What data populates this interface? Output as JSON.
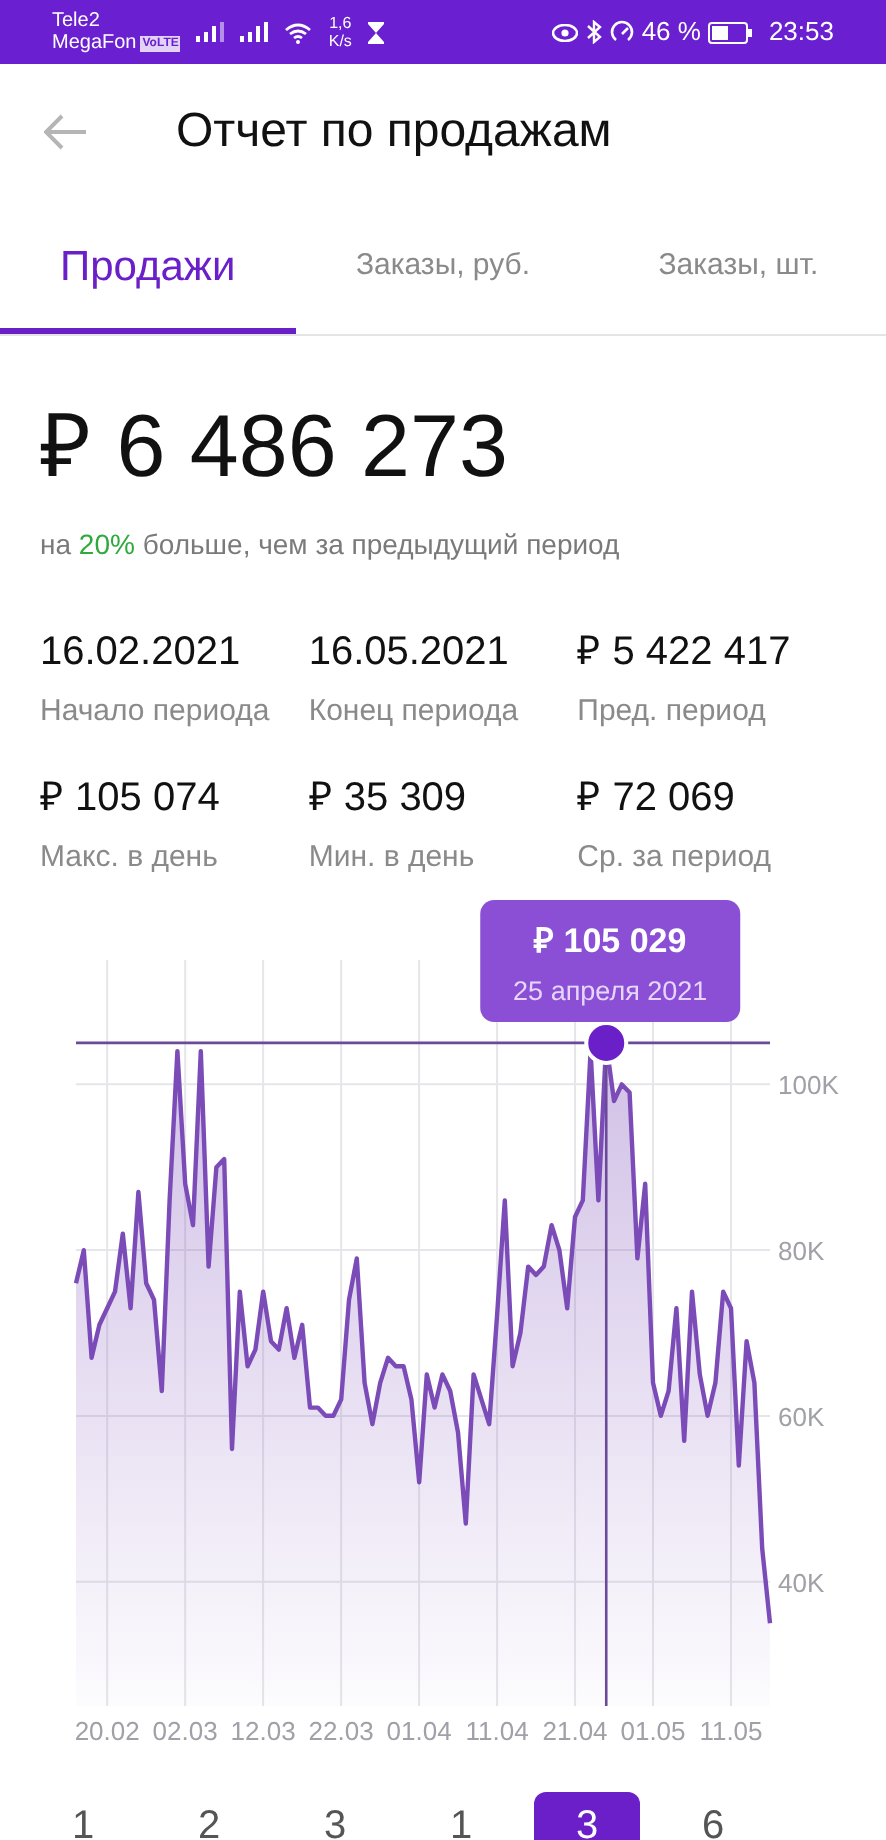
{
  "status_bar": {
    "carrier_1": "Tele2",
    "carrier_2": "MegaFon",
    "volte": "VoLTE",
    "speed": "1,6",
    "speed_unit": "K/s",
    "battery": "46 %",
    "time": "23:53"
  },
  "header": {
    "title": "Отчет по продажам"
  },
  "tabs": [
    {
      "label": "Продажи",
      "selected": true
    },
    {
      "label": "Заказы, руб.",
      "selected": false
    },
    {
      "label": "Заказы, шт.",
      "selected": false
    }
  ],
  "total": {
    "value": "₽ 6 486 273",
    "comparison": {
      "prefix": "на ",
      "highlight": "20%",
      "suffix": " больше, чем за предыдущий период"
    }
  },
  "stats": [
    {
      "value": "16.02.2021",
      "label": "Начало периода"
    },
    {
      "value": "16.05.2021",
      "label": "Конец периода"
    },
    {
      "value": "₽ 5 422 417",
      "label": "Пред. период"
    },
    {
      "value": "₽ 105 074",
      "label": "Макс. в день"
    },
    {
      "value": "₽ 35 309",
      "label": "Мин. в день"
    },
    {
      "value": "₽ 72 069",
      "label": "Ср. за период"
    }
  ],
  "chart_data": {
    "type": "area",
    "categories": [
      null,
      null,
      null,
      null,
      "20.02",
      null,
      null,
      null,
      null,
      null,
      null,
      null,
      null,
      null,
      "02.03",
      null,
      null,
      null,
      null,
      null,
      null,
      null,
      null,
      null,
      "12.03",
      null,
      null,
      null,
      null,
      null,
      null,
      null,
      null,
      null,
      "22.03",
      null,
      null,
      null,
      null,
      null,
      null,
      null,
      null,
      null,
      "01.04",
      null,
      null,
      null,
      null,
      null,
      null,
      null,
      null,
      null,
      "11.04",
      null,
      null,
      null,
      null,
      null,
      null,
      null,
      null,
      null,
      "21.04",
      null,
      null,
      null,
      null,
      null,
      null,
      null,
      null,
      null,
      "01.05",
      null,
      null,
      null,
      null,
      null,
      null,
      null,
      null,
      null,
      "11.05",
      null,
      null,
      null,
      null,
      null
    ],
    "series": [
      {
        "color": "#7b4bb8",
        "values": [
          76,
          80,
          67,
          71,
          73,
          75,
          82,
          73,
          87,
          76,
          74,
          63,
          86,
          104,
          88,
          83,
          104,
          78,
          90,
          91,
          56,
          75,
          66,
          68,
          75,
          69,
          68,
          73,
          67,
          71,
          61,
          61,
          60,
          60,
          62,
          74,
          79,
          64,
          59,
          64,
          67,
          66,
          66,
          62,
          52,
          65,
          61,
          65,
          63,
          58,
          47,
          65,
          62,
          59,
          72,
          86,
          66,
          70,
          78,
          77,
          78,
          83,
          80,
          73,
          84,
          86,
          104,
          86,
          105,
          98,
          100,
          99,
          79,
          88,
          64,
          60,
          63,
          73,
          57,
          75,
          65,
          60,
          64,
          75,
          73,
          54,
          69,
          64,
          44,
          35
        ]
      }
    ],
    "grid": true,
    "ylim": [
      25,
      115
    ],
    "ref_lines": [
      {
        "axis": "y",
        "value": 105
      }
    ],
    "yticks": [
      {
        "value": 40,
        "label": "40K"
      },
      {
        "value": 60,
        "label": "60K"
      },
      {
        "value": 80,
        "label": "80K"
      },
      {
        "value": 100,
        "label": "100K"
      }
    ],
    "annotations": [
      {
        "text": "₽ 105 029"
      },
      {
        "text": "25 апреля 2021"
      }
    ]
  },
  "pages": [
    {
      "label": "1",
      "selected": false
    },
    {
      "label": "2",
      "selected": false
    },
    {
      "label": "3",
      "selected": false
    },
    {
      "label": "1",
      "selected": false
    },
    {
      "label": "3",
      "selected": true
    },
    {
      "label": "6",
      "selected": false
    }
  ]
}
